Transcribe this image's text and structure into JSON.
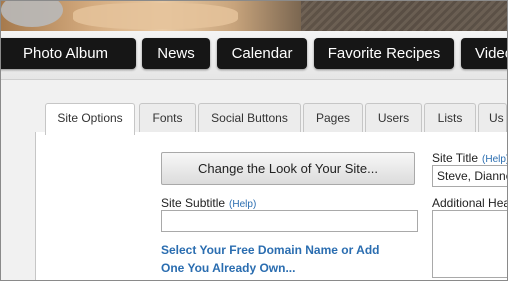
{
  "nav": {
    "items": [
      "Photo Album",
      "News",
      "Calendar",
      "Favorite Recipes",
      "Video"
    ]
  },
  "tabs": [
    "Site Options",
    "Fonts",
    "Social Buttons",
    "Pages",
    "Users",
    "Lists",
    "Us"
  ],
  "site_options": {
    "change_look_label": "Change the Look of Your Site...",
    "site_subtitle_label": "Site Subtitle",
    "site_subtitle_value": "",
    "help_label": "(Help)",
    "domain_link": "Select Your Free Domain Name or Add One You Already Own...",
    "site_title_label": "Site Title",
    "site_title_help": "(Help)",
    "site_title_value": "Steve, Dianne",
    "additional_header_label": "Additional Hea"
  },
  "colors": {
    "nav_button_bg": "#161616",
    "link_blue": "#2a6db0",
    "tab_active_bg": "#ffffff",
    "tab_inactive_bg": "#ececec"
  }
}
